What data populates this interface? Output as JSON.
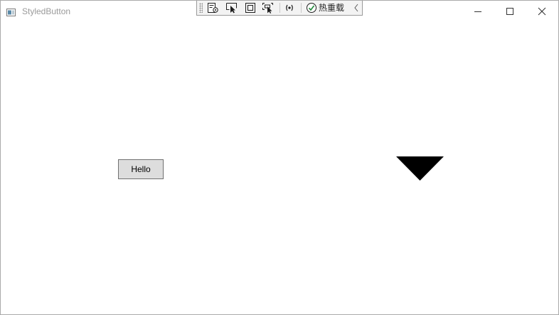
{
  "window": {
    "title": "StyledButton",
    "icon": "app-window-icon",
    "controls": {
      "minimize_icon": "minimize-icon",
      "maximize_icon": "maximize-icon",
      "close_icon": "close-icon"
    }
  },
  "debug_toolbar": {
    "items": [
      {
        "icon": "live-visual-tree-icon"
      },
      {
        "icon": "select-element-icon"
      },
      {
        "icon": "display-layout-adorners-icon"
      },
      {
        "icon": "track-focused-element-icon"
      },
      {
        "icon": "binding-failures-icon"
      }
    ],
    "hot_reload_icon": "checkmark-circle-icon",
    "hot_reload_label": "热重载",
    "collapse_icon": "chevron-left-icon"
  },
  "content": {
    "button_label": "Hello",
    "shape": "triangle-down",
    "shape_color": "#000000"
  }
}
